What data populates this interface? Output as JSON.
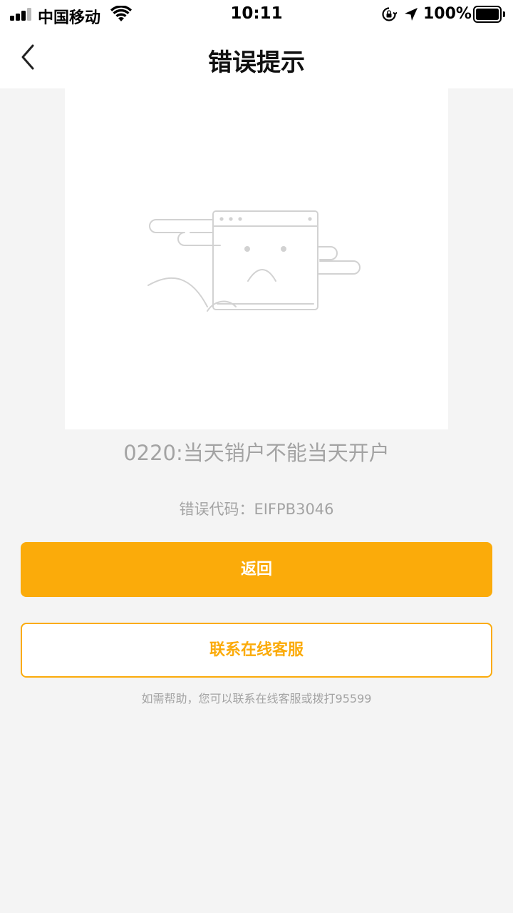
{
  "status_bar": {
    "carrier": "中国移动",
    "time": "10:11",
    "battery_percent": "100%",
    "icons": [
      "signal-icon",
      "wifi-icon",
      "rotation-lock-icon",
      "location-arrow-icon",
      "battery-icon"
    ]
  },
  "nav": {
    "title": "错误提示",
    "back_icon": "chevron-left-icon"
  },
  "illustration": {
    "icon": "sad-browser-window-illustration"
  },
  "error": {
    "message": "0220:当天销户不能当天开户",
    "code_label": "错误代码：",
    "code_value": "EIFPB3046"
  },
  "actions": {
    "back_label": "返回",
    "contact_label": "联系在线客服"
  },
  "help": {
    "text": "如需帮助，您可以联系在线客服或拨打95599"
  },
  "colors": {
    "accent": "#fbab0a",
    "background": "#f4f4f4",
    "muted_text": "#a3a3a3"
  }
}
